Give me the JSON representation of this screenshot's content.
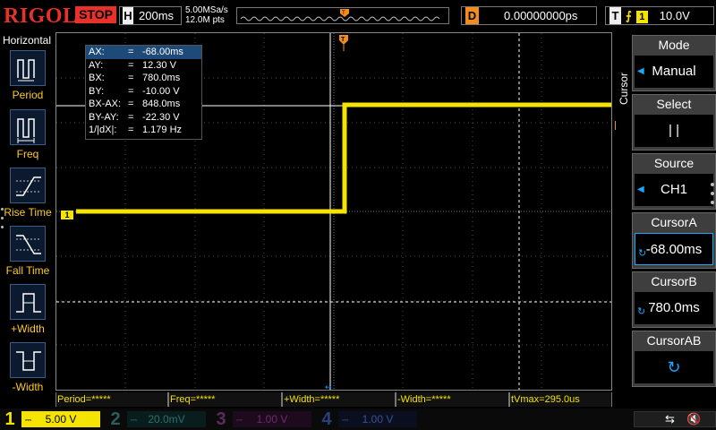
{
  "brand": "RIGOL",
  "run_state": "STOP",
  "timebase": {
    "label": "H",
    "value": "200ms"
  },
  "sample": {
    "rate": "5.00MSa/s",
    "points": "12.0M pts"
  },
  "delay": {
    "label": "D",
    "value": "0.00000000ps"
  },
  "trigger": {
    "label": "T",
    "edge_icon": "rising-edge-icon",
    "source": "1",
    "level": "10.0V"
  },
  "left_menu": {
    "title": "Horizontal",
    "items": [
      {
        "label": "Period",
        "icon": "period-icon"
      },
      {
        "label": "Freq",
        "icon": "freq-icon"
      },
      {
        "label": "Rise Time",
        "icon": "rise-time-icon"
      },
      {
        "label": "Fall Time",
        "icon": "fall-time-icon"
      },
      {
        "label": "+Width",
        "icon": "pos-width-icon"
      },
      {
        "label": "-Width",
        "icon": "neg-width-icon"
      }
    ]
  },
  "cursor_readout": {
    "rows": [
      {
        "name": "AX:",
        "eq": "=",
        "value": "-68.00ms"
      },
      {
        "name": "AY:",
        "eq": "=",
        "value": "12.30 V"
      },
      {
        "name": "BX:",
        "eq": "=",
        "value": "780.0ms"
      },
      {
        "name": "BY:",
        "eq": "=",
        "value": "-10.00 V"
      },
      {
        "name": "BX-AX:",
        "eq": "=",
        "value": "848.0ms"
      },
      {
        "name": "BY-AY:",
        "eq": "=",
        "value": "-22.30 V"
      },
      {
        "name": "1/|dX|:",
        "eq": "=",
        "value": "1.179 Hz"
      }
    ]
  },
  "markers": {
    "ch1": "1",
    "trigger_level": "T",
    "trigger_pos": "T"
  },
  "right_menu": {
    "vertical_title": "Cursor",
    "mode": {
      "title": "Mode",
      "value": "Manual"
    },
    "select": {
      "title": "Select",
      "value": "|   |"
    },
    "source": {
      "title": "Source",
      "value": "CH1"
    },
    "cursor_a": {
      "title": "CursorA",
      "value": "-68.00ms"
    },
    "cursor_b": {
      "title": "CursorB",
      "value": "780.0ms"
    },
    "cursor_ab": {
      "title": "CursorAB"
    }
  },
  "measurements": [
    "Period=*****",
    "Freq=*****",
    "+Width=*****",
    "-Width=*****",
    "tVmax=295.0us"
  ],
  "channels": [
    {
      "num": "1",
      "scale": "5.00 V",
      "color": "#f5e300",
      "active": true
    },
    {
      "num": "2",
      "scale": "20.0mV",
      "color": "#1fc3c3",
      "active": false
    },
    {
      "num": "3",
      "scale": "1.00 V",
      "color": "#e040e0",
      "active": false
    },
    {
      "num": "4",
      "scale": "1.00 V",
      "color": "#2a6cff",
      "active": false
    }
  ],
  "status_icons": [
    "usb-icon",
    "speaker-mute-icon"
  ],
  "colors": {
    "ch1": "#f5e300",
    "trigger": "#f28c1e",
    "brand": "#e8312a",
    "accent": "#19a8ff"
  }
}
